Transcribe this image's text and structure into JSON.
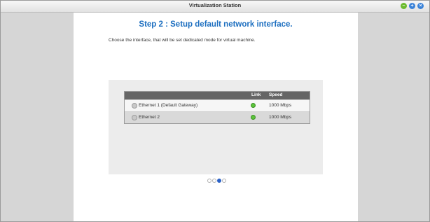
{
  "window": {
    "title": "Virtualization Station",
    "buttons": {
      "minimize": "–",
      "maximize": "+",
      "close": "×"
    }
  },
  "wizard": {
    "heading": "Step 2 : Setup default network interface.",
    "subtitle": "Choose the interface, that will be set dedicated mode for virtual machine.",
    "table": {
      "columns": {
        "link": "Link",
        "speed": "Speed"
      },
      "rows": [
        {
          "name": "Ethernet 1 (Default Gateway)",
          "link_status": "up",
          "speed": "1000 Mbps"
        },
        {
          "name": "Ethernet 2",
          "link_status": "up",
          "speed": "1000 Mbps"
        }
      ]
    },
    "nav": {
      "prev": "◀",
      "next": "▶"
    },
    "pagination": {
      "total": 4,
      "current": 3
    }
  },
  "colors": {
    "heading": "#1d6fc0",
    "link_up": "#5cc43a",
    "header_bg": "#656565"
  }
}
